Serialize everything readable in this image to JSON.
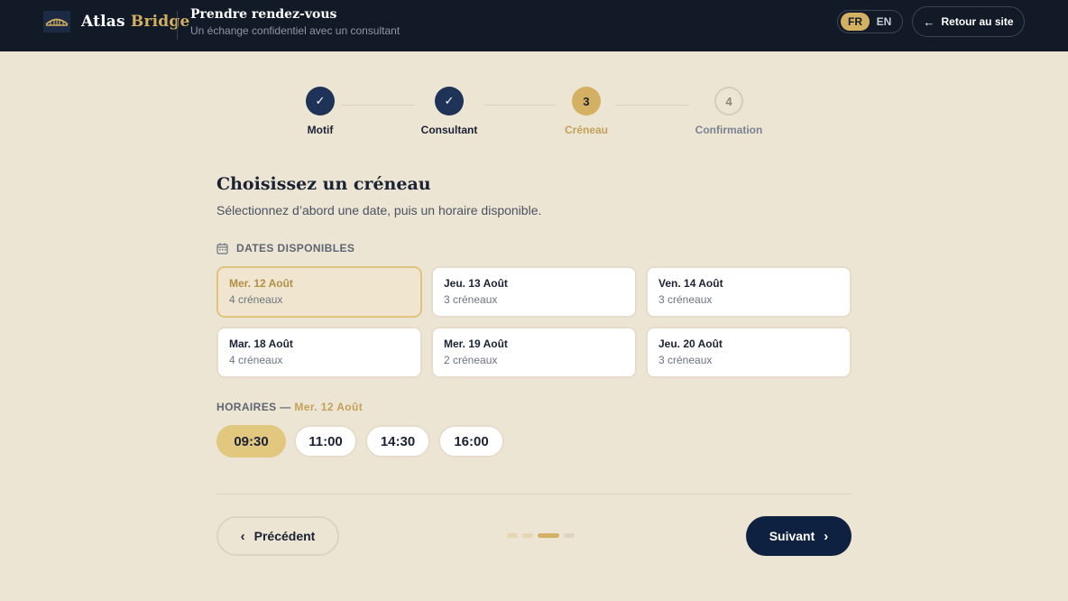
{
  "header": {
    "brand_main": "Atlas",
    "brand_accent": "Bridge",
    "title": "Prendre rendez-vous",
    "subtitle": "Un échange confidentiel avec un consultant",
    "lang_options": [
      "FR",
      "EN"
    ],
    "lang_active": "FR",
    "back_label": "Retour au site",
    "back_icon": "arrow-left-icon"
  },
  "stepper": {
    "steps": [
      {
        "number": "✓",
        "label": "Motif",
        "state": "done"
      },
      {
        "number": "✓",
        "label": "Consultant",
        "state": "done"
      },
      {
        "number": "3",
        "label": "Créneau",
        "state": "current"
      },
      {
        "number": "4",
        "label": "Confirmation",
        "state": "future"
      }
    ]
  },
  "main": {
    "title": "Choisissez un créneau",
    "subtitle": "Sélectionnez d’abord une date, puis un horaire disponible.",
    "dates_label": "DATES DISPONIBLES",
    "dates_icon": "calendar-icon",
    "dates": [
      {
        "name": "Mer. 12 Août",
        "slots": "4 créneaux",
        "selected": true
      },
      {
        "name": "Jeu. 13 Août",
        "slots": "3 créneaux",
        "selected": false
      },
      {
        "name": "Ven. 14 Août",
        "slots": "3 créneaux",
        "selected": false
      },
      {
        "name": "Mar. 18 Août",
        "slots": "4 créneaux",
        "selected": false
      },
      {
        "name": "Mer. 19 Août",
        "slots": "2 créneaux",
        "selected": false
      },
      {
        "name": "Jeu. 20 Août",
        "slots": "3 créneaux",
        "selected": false
      }
    ],
    "hours_label": "HORAIRES —",
    "hours_selected_date": "Mer. 12 Août",
    "times": [
      {
        "value": "09:30",
        "selected": true
      },
      {
        "value": "11:00",
        "selected": false
      },
      {
        "value": "14:30",
        "selected": false
      },
      {
        "value": "16:00",
        "selected": false
      }
    ]
  },
  "footer": {
    "prev_label": "Précédent",
    "next_label": "Suivant",
    "progress_current_step": 3,
    "progress_total_steps": 4
  },
  "colors": {
    "header_bg": "#121a28",
    "page_bg": "#ede5d4",
    "gold_accent": "#d3b062",
    "navy": "#0f2140"
  }
}
